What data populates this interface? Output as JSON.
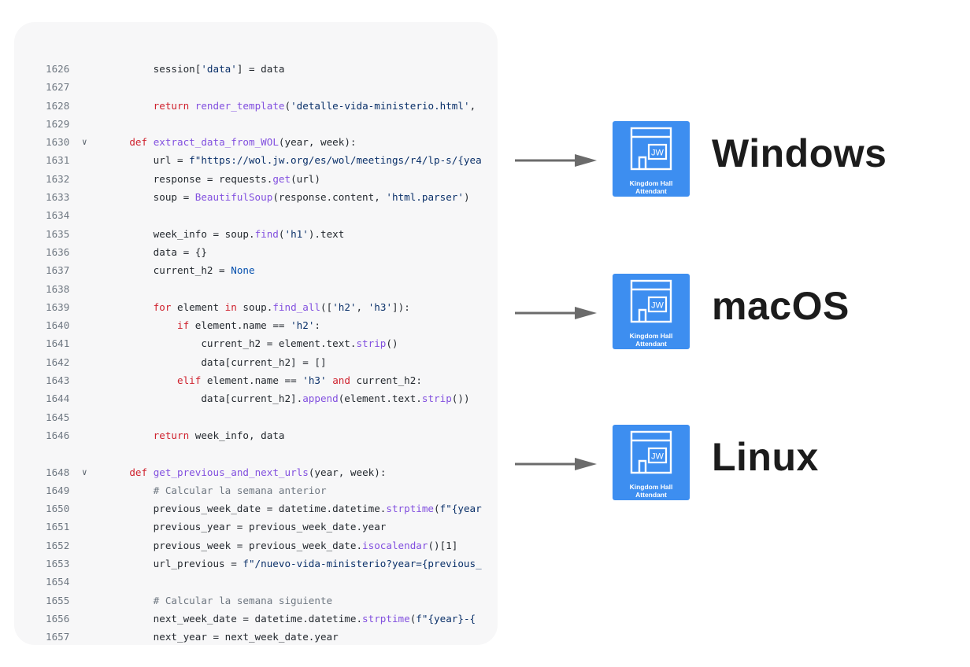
{
  "code": {
    "lines": [
      {
        "n": "1626",
        "fold": "",
        "html": "        session[<span class='st'>'data'</span>] = data"
      },
      {
        "n": "1627",
        "fold": "",
        "html": ""
      },
      {
        "n": "1628",
        "fold": "",
        "html": "        <span class='kw'>return</span> <span class='fn'>render_template</span>(<span class='st'>'detalle-vida-ministerio.html'</span>,"
      },
      {
        "n": "1629",
        "fold": "",
        "html": ""
      },
      {
        "n": "1630",
        "fold": "∨",
        "html": "    <span class='kw'>def</span> <span class='fn'>extract_data_from_WOL</span>(year, week):"
      },
      {
        "n": "1631",
        "fold": "",
        "html": "        url = <span class='st'>f\"https://wol.jw.org/es/wol/meetings/r4/lp-s/{yea</span>"
      },
      {
        "n": "1632",
        "fold": "",
        "html": "        response = requests.<span class='fn'>get</span>(url)"
      },
      {
        "n": "1633",
        "fold": "",
        "html": "        soup = <span class='fn'>BeautifulSoup</span>(response.content, <span class='st'>'html.parser'</span>)"
      },
      {
        "n": "1634",
        "fold": "",
        "html": ""
      },
      {
        "n": "1635",
        "fold": "",
        "html": "        week_info = soup.<span class='fn'>find</span>(<span class='st'>'h1'</span>).text"
      },
      {
        "n": "1636",
        "fold": "",
        "html": "        data = {}"
      },
      {
        "n": "1637",
        "fold": "",
        "html": "        current_h2 = <span class='bl'>None</span>"
      },
      {
        "n": "1638",
        "fold": "",
        "html": ""
      },
      {
        "n": "1639",
        "fold": "",
        "html": "        <span class='kw'>for</span> element <span class='kw'>in</span> soup.<span class='fn'>find_all</span>([<span class='st'>'h2'</span>, <span class='st'>'h3'</span>]):"
      },
      {
        "n": "1640",
        "fold": "",
        "html": "            <span class='kw'>if</span> element.name == <span class='st'>'h2'</span>:"
      },
      {
        "n": "1641",
        "fold": "",
        "html": "                current_h2 = element.text.<span class='fn'>strip</span>()"
      },
      {
        "n": "1642",
        "fold": "",
        "html": "                data[current_h2] = []"
      },
      {
        "n": "1643",
        "fold": "",
        "html": "            <span class='kw'>elif</span> element.name == <span class='st'>'h3'</span> <span class='kw'>and</span> current_h2:"
      },
      {
        "n": "1644",
        "fold": "",
        "html": "                data[current_h2].<span class='fn'>append</span>(element.text.<span class='fn'>strip</span>())"
      },
      {
        "n": "1645",
        "fold": "",
        "html": ""
      },
      {
        "n": "1646",
        "fold": "",
        "html": "        <span class='kw'>return</span> week_info, data"
      },
      {
        "n": "",
        "fold": "",
        "html": ""
      },
      {
        "n": "1648",
        "fold": "∨",
        "html": "    <span class='kw'>def</span> <span class='fn'>get_previous_and_next_urls</span>(year, week):"
      },
      {
        "n": "1649",
        "fold": "",
        "html": "        <span class='cm'># Calcular la semana anterior</span>"
      },
      {
        "n": "1650",
        "fold": "",
        "html": "        previous_week_date = datetime.datetime.<span class='fn'>strptime</span>(<span class='st'>f\"{year</span>"
      },
      {
        "n": "1651",
        "fold": "",
        "html": "        previous_year = previous_week_date.year"
      },
      {
        "n": "1652",
        "fold": "",
        "html": "        previous_week = previous_week_date.<span class='fn'>isocalendar</span>()[1]"
      },
      {
        "n": "1653",
        "fold": "",
        "html": "        url_previous = <span class='st'>f\"/nuevo-vida-ministerio?year={previous_</span>"
      },
      {
        "n": "1654",
        "fold": "",
        "html": ""
      },
      {
        "n": "1655",
        "fold": "",
        "html": "        <span class='cm'># Calcular la semana siguiente</span>"
      },
      {
        "n": "1656",
        "fold": "",
        "html": "        next_week_date = datetime.datetime.<span class='fn'>strptime</span>(<span class='st'>f\"{year}-{</span>"
      },
      {
        "n": "1657",
        "fold": "",
        "html": "        next_year = next_week_date.year"
      }
    ]
  },
  "app": {
    "badge": "JW",
    "caption_line1": "Kingdom Hall",
    "caption_line2": "Attendant",
    "icon_name": "kingdom-hall-app-icon",
    "icon_color": "#3d8ef0"
  },
  "platforms": [
    {
      "label": "Windows"
    },
    {
      "label": "macOS"
    },
    {
      "label": "Linux"
    }
  ],
  "colors": {
    "arrow": "#6b6b6b",
    "label": "#1c1c1c",
    "card_bg": "#f7f7f8"
  }
}
